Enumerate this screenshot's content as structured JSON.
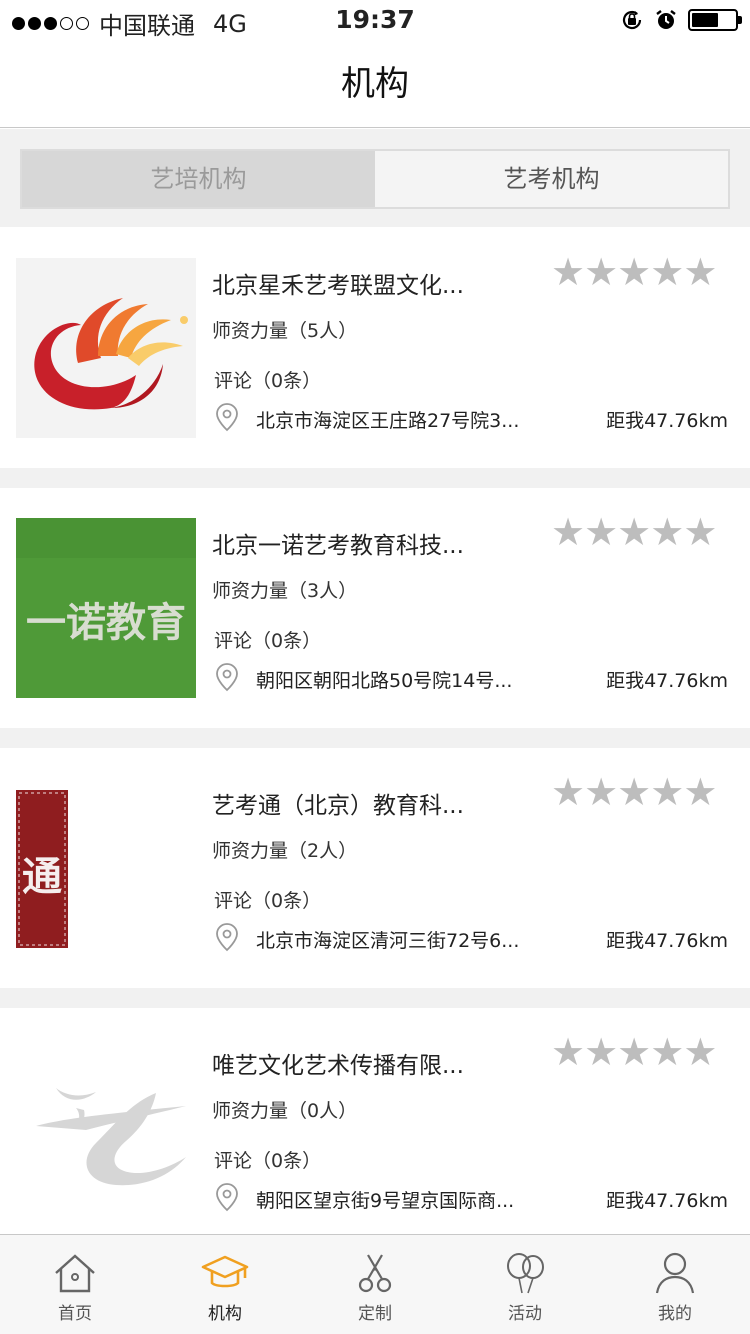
{
  "status": {
    "carrier": "中国联通",
    "network": "4G",
    "time": "19:37"
  },
  "header": {
    "title": "机构"
  },
  "segment": {
    "left": "艺培机构",
    "right": "艺考机构"
  },
  "institutions": [
    {
      "name": "北京星禾艺考联盟文化...",
      "teachers": "师资力量（5人）",
      "comments": "评论（0条）",
      "address": "北京市海淀区王庄路27号院3...",
      "distance": "距我47.76km",
      "logo": "xinghe-logo"
    },
    {
      "name": "北京一诺艺考教育科技...",
      "teachers": "师资力量（3人）",
      "comments": "评论（0条）",
      "address": "朝阳区朝阳北路50号院14号...",
      "distance": "距我47.76km",
      "logo": "yinuo-logo",
      "logo_text": "一诺教育"
    },
    {
      "name": "艺考通（北京）教育科...",
      "teachers": "师资力量（2人）",
      "comments": "评论（0条）",
      "address": "北京市海淀区清河三街72号6...",
      "distance": "距我47.76km",
      "logo": "yikaotong-logo",
      "logo_text": "通"
    },
    {
      "name": "唯艺文化艺术传播有限...",
      "teachers": "师资力量（0人）",
      "comments": "评论（0条）",
      "address": "朝阳区望京街9号望京国际商...",
      "distance": "距我47.76km",
      "logo": "weiyi-logo"
    }
  ],
  "tabbar": [
    {
      "label": "首页",
      "icon": "home-icon"
    },
    {
      "label": "机构",
      "icon": "graduation-cap-icon",
      "active": true
    },
    {
      "label": "定制",
      "icon": "scissors-icon"
    },
    {
      "label": "活动",
      "icon": "balloons-icon"
    },
    {
      "label": "我的",
      "icon": "user-icon"
    }
  ],
  "colors": {
    "accent": "#f0a020",
    "star": "#bdbdbd",
    "background": "#f1f1f1"
  }
}
